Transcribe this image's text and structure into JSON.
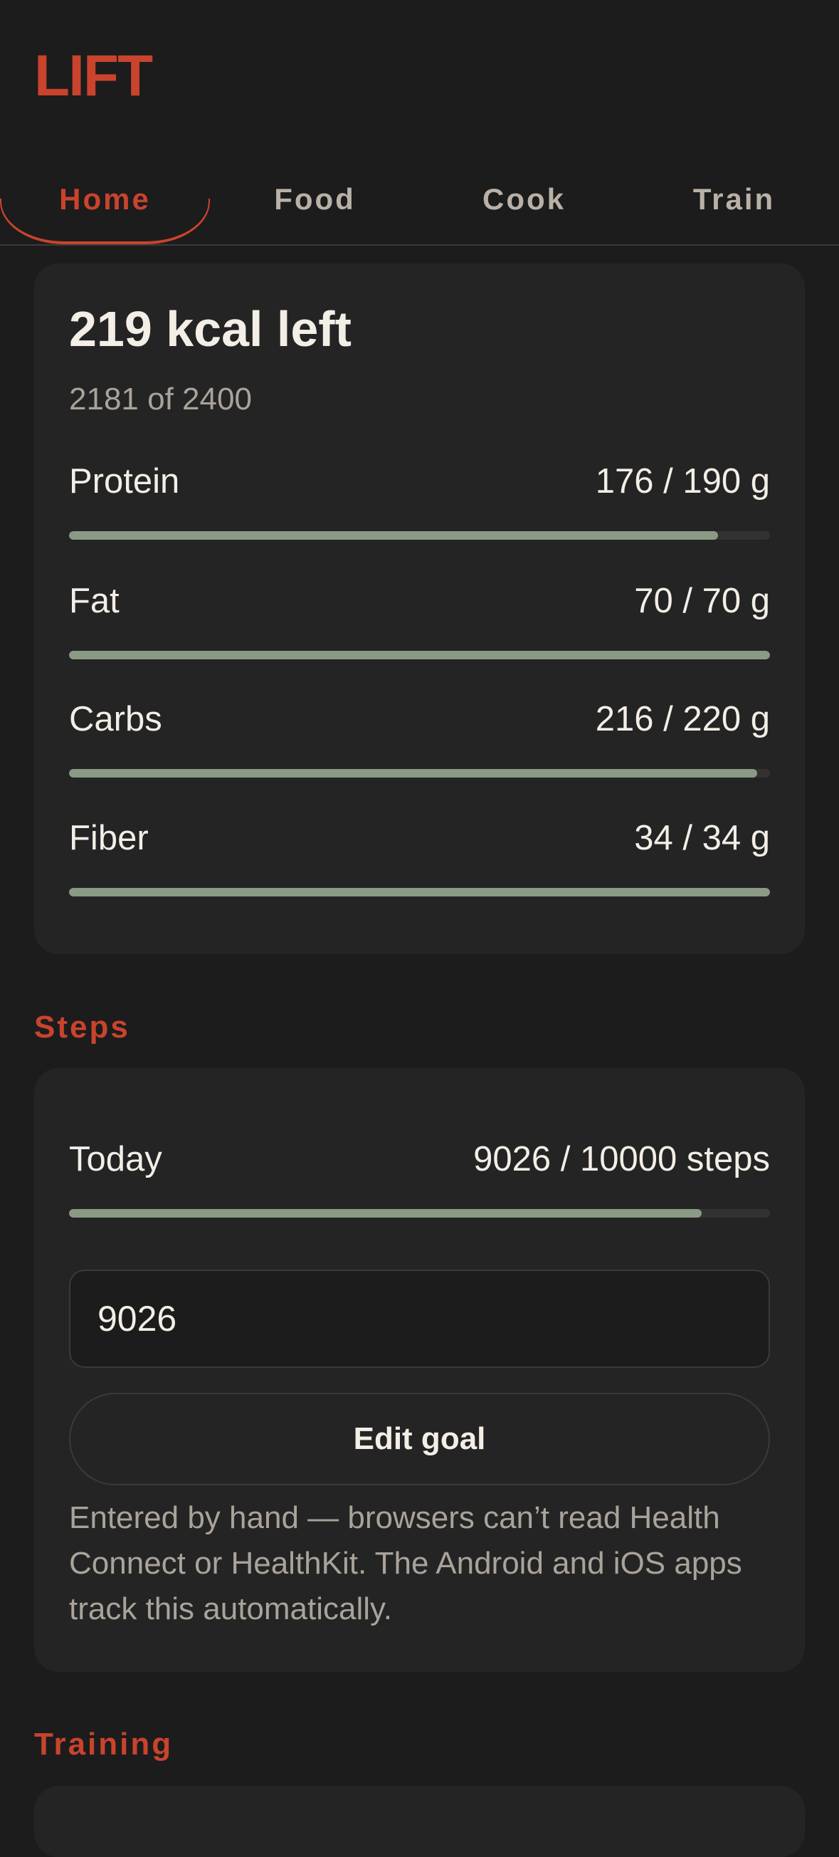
{
  "app": {
    "title": "LIFT"
  },
  "tabs": [
    {
      "label": "Home",
      "active": true
    },
    {
      "label": "Food",
      "active": false
    },
    {
      "label": "Cook",
      "active": false
    },
    {
      "label": "Train",
      "active": false
    }
  ],
  "summary": {
    "title": "219 kcal left",
    "subtitle": "2181 of 2400",
    "macros": [
      {
        "label": "Protein",
        "value": "176 / 190 g",
        "progress": 0.926
      },
      {
        "label": "Fat",
        "value": "70 / 70 g",
        "progress": 1.0
      },
      {
        "label": "Carbs",
        "value": "216 / 220 g",
        "progress": 0.982
      },
      {
        "label": "Fiber",
        "value": "34 / 34 g",
        "progress": 1.0
      }
    ]
  },
  "steps": {
    "heading": "Steps",
    "row_label": "Today",
    "row_value": "9026 / 10000 steps",
    "progress": 0.9026,
    "input_value": "9026",
    "edit_goal_label": "Edit goal",
    "note": "Entered by hand — browsers can’t read Health Connect or HealthKit. The Android and iOS apps track this automatically."
  },
  "training": {
    "heading": "Training"
  },
  "colors": {
    "accent": "#c9432d",
    "background": "#1c1c1c",
    "card": "#242424",
    "progress_fill": "#8a9a85",
    "progress_track": "#333231",
    "text_primary": "#f3eee6",
    "text_secondary": "#a9a39a"
  }
}
